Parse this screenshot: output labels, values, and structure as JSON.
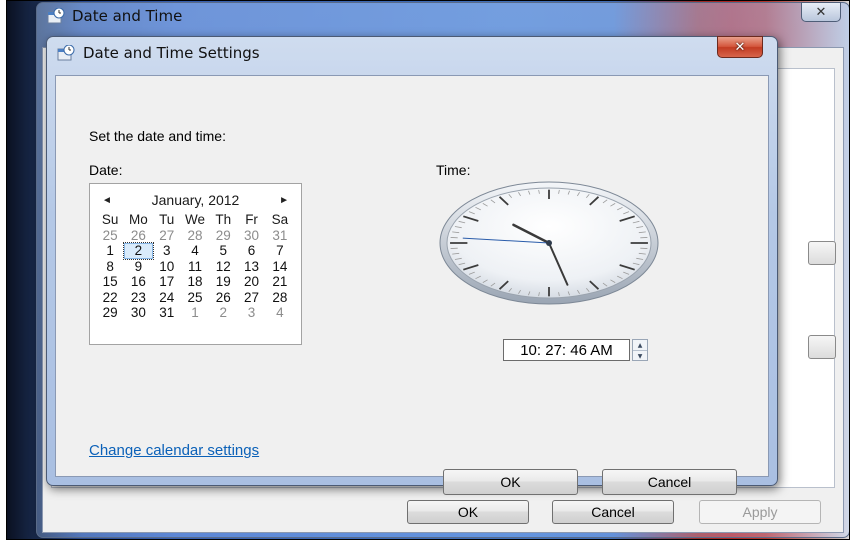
{
  "outer_window": {
    "title": "Date and Time",
    "close_glyph": "✕",
    "buttons": {
      "ok": "OK",
      "cancel": "Cancel",
      "apply": "Apply"
    }
  },
  "dialog": {
    "title": "Date and Time Settings",
    "close_glyph": "✕",
    "instruction": "Set the date and time:",
    "date_label": "Date:",
    "time_label": "Time:",
    "calendar": {
      "month_label": "January, 2012",
      "prev_glyph": "◄",
      "next_glyph": "►",
      "weekdays": [
        "Su",
        "Mo",
        "Tu",
        "We",
        "Th",
        "Fr",
        "Sa"
      ],
      "days": [
        {
          "d": "25",
          "other": true
        },
        {
          "d": "26",
          "other": true
        },
        {
          "d": "27",
          "other": true
        },
        {
          "d": "28",
          "other": true
        },
        {
          "d": "29",
          "other": true
        },
        {
          "d": "30",
          "other": true
        },
        {
          "d": "31",
          "other": true
        },
        {
          "d": "1"
        },
        {
          "d": "2",
          "selected": true
        },
        {
          "d": "3"
        },
        {
          "d": "4"
        },
        {
          "d": "5"
        },
        {
          "d": "6"
        },
        {
          "d": "7"
        },
        {
          "d": "8"
        },
        {
          "d": "9"
        },
        {
          "d": "10"
        },
        {
          "d": "11"
        },
        {
          "d": "12"
        },
        {
          "d": "13"
        },
        {
          "d": "14"
        },
        {
          "d": "15"
        },
        {
          "d": "16"
        },
        {
          "d": "17"
        },
        {
          "d": "18"
        },
        {
          "d": "19"
        },
        {
          "d": "20"
        },
        {
          "d": "21"
        },
        {
          "d": "22"
        },
        {
          "d": "23"
        },
        {
          "d": "24"
        },
        {
          "d": "25"
        },
        {
          "d": "26"
        },
        {
          "d": "27"
        },
        {
          "d": "28"
        },
        {
          "d": "29"
        },
        {
          "d": "30"
        },
        {
          "d": "31"
        },
        {
          "d": "1",
          "other": true
        },
        {
          "d": "2",
          "other": true
        },
        {
          "d": "3",
          "other": true
        },
        {
          "d": "4",
          "other": true
        }
      ]
    },
    "clock": {
      "hour": 10,
      "minute": 27,
      "second": 46
    },
    "time_value": "10: 27: 46 AM",
    "change_calendar_link": "Change calendar settings",
    "ok_label": "OK",
    "cancel_label": "Cancel"
  },
  "colors": {
    "link": "#0b61b8",
    "dialog_close": "#c23b22",
    "selected_day": "#d9ebfb"
  },
  "icons": {
    "window_icon": "clock-icon",
    "spin_up": "▲",
    "spin_down": "▼"
  }
}
